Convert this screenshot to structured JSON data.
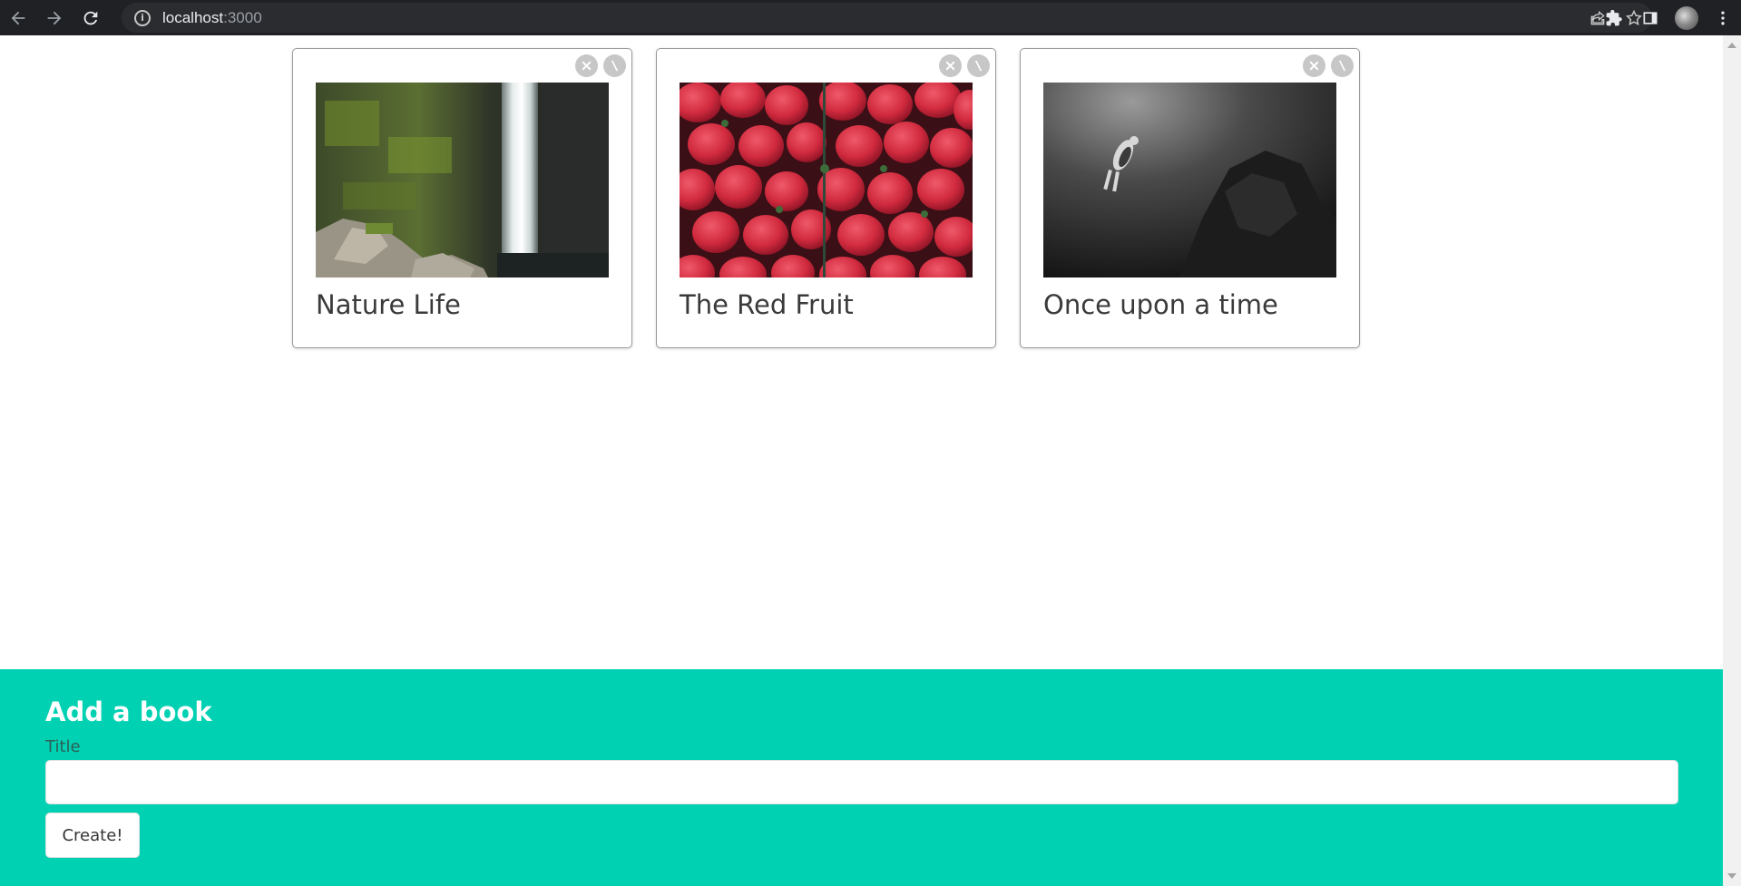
{
  "browser": {
    "url_host": "localhost",
    "url_port": ":3000"
  },
  "books": [
    {
      "title": "Nature Life",
      "image": "waterfall"
    },
    {
      "title": "The Red Fruit",
      "image": "strawberries"
    },
    {
      "title": "Once upon a time",
      "image": "diver"
    }
  ],
  "add_book": {
    "heading": "Add a book",
    "title_label": "Title",
    "title_value": "",
    "create_label": "Create!"
  },
  "icons": {
    "delete": "close-icon",
    "edit": "edit-icon"
  },
  "colors": {
    "panel": "#00d1b2",
    "chrome": "#202124"
  }
}
